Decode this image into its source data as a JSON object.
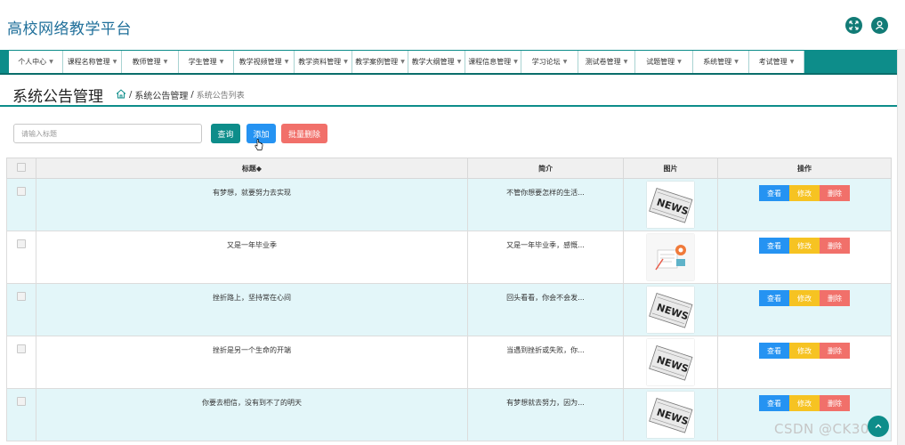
{
  "app": {
    "title": "高校网络教学平台",
    "accent_color": "#0d8d8a"
  },
  "header_icons": [
    "expand-icon",
    "user-icon"
  ],
  "nav": {
    "items": [
      {
        "label": "个人中心"
      },
      {
        "label": "课程名称管理"
      },
      {
        "label": "教师管理"
      },
      {
        "label": "学生管理"
      },
      {
        "label": "教学视频管理"
      },
      {
        "label": "教学资料管理"
      },
      {
        "label": "教学案例管理"
      },
      {
        "label": "教学大纲管理"
      },
      {
        "label": "课程信息管理"
      },
      {
        "label": "学习论坛"
      },
      {
        "label": "测试卷管理"
      },
      {
        "label": "试题管理"
      },
      {
        "label": "系统管理"
      },
      {
        "label": "考试管理"
      }
    ]
  },
  "page": {
    "title": "系统公告管理",
    "breadcrumb": {
      "sep": "/",
      "level1": "系统公告管理",
      "current": "系统公告列表"
    }
  },
  "search": {
    "placeholder": "请输入标题",
    "value": ""
  },
  "buttons": {
    "query": "查询",
    "add": "添加",
    "batch_delete": "批量删除",
    "colors": {
      "query": "#0d8d8a",
      "add": "#2593f2",
      "batch_delete": "#f1706a"
    }
  },
  "table": {
    "headers": {
      "title": "标题◆",
      "brief": "简介",
      "image": "图片",
      "actions": "操作"
    },
    "rows": [
      {
        "title": "有梦想，就要努力去实现",
        "brief": "不管你想要怎样的生活...",
        "image": "news-image"
      },
      {
        "title": "又是一年毕业季",
        "brief": "又是一年毕业季，感慨...",
        "image": "graduation-image"
      },
      {
        "title": "挫折路上，坚持常在心间",
        "brief": "回头看看，你会不会发...",
        "image": "news-image"
      },
      {
        "title": "挫折是另一个生命的开端",
        "brief": "当遇到挫折或失败，你...",
        "image": "news-image"
      },
      {
        "title": "你要去相信，没有到不了的明天",
        "brief": "有梦想就去努力，因为...",
        "image": "news-image"
      }
    ],
    "actions": {
      "view": "查看",
      "edit": "修改",
      "delete": "删除"
    },
    "action_colors": {
      "view": "#2593f2",
      "edit": "#f6c322",
      "delete": "#f1706a"
    }
  },
  "watermark": "CSDN @CK3011"
}
